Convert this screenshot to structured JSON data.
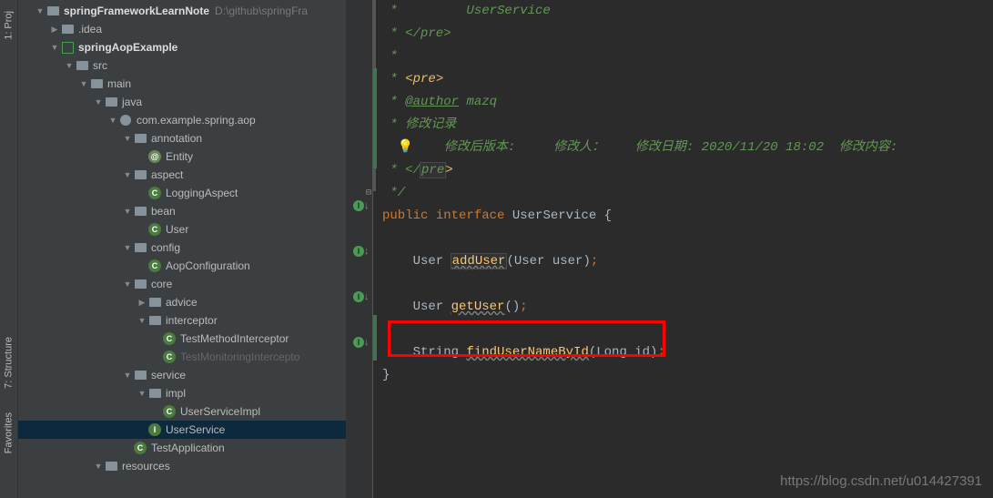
{
  "gutter_tabs": {
    "project": "1: Proj",
    "structure": "7: Structure",
    "favorites": "Favorites"
  },
  "tree": {
    "root": {
      "name": "springFrameworkLearnNote",
      "path": "D:\\github\\springFra"
    },
    "idea": ".idea",
    "module": "springAopExample",
    "src": "src",
    "main": "main",
    "java": "java",
    "pkg": "com.example.spring.aop",
    "annotation": {
      "dir": "annotation",
      "files": [
        "Entity"
      ]
    },
    "aspect": {
      "dir": "aspect",
      "files": [
        "LoggingAspect"
      ]
    },
    "bean": {
      "dir": "bean",
      "files": [
        "User"
      ]
    },
    "config": {
      "dir": "config",
      "files": [
        "AopConfiguration"
      ]
    },
    "core": {
      "dir": "core",
      "advice": "advice",
      "interceptor": "interceptor",
      "int_files": [
        "TestMethodInterceptor",
        "TestMonitoringIntercepto"
      ]
    },
    "service": {
      "dir": "service",
      "impl": "impl",
      "impl_files": [
        "UserServiceImpl"
      ],
      "files": [
        "UserService"
      ]
    },
    "testapp": "TestApplication",
    "resources": "resources"
  },
  "code": {
    "l1": " *         UserService",
    "l2": " * </pre>",
    "l3": " *",
    "l4_a": " * ",
    "l4_b": "<pre>",
    "l5_a": " * ",
    "l5_b": "@author",
    "l5_c": " mazq",
    "l6": " * 修改记录",
    "l7_a": "    修改后版本:     修改人：    修改日期: ",
    "l7_b": "2020/11/20 18:02",
    "l7_c": "  修改内容:",
    "l8_a": " * </",
    "l8_b": "pre",
    "l8_c": ">",
    "l9": " */",
    "l10_a": "public",
    "l10_b": " interface",
    "l10_c": " UserService {",
    "l12_a": "    User ",
    "l12_b": "addUser",
    "l12_c": "(User user)",
    "l12_d": ";",
    "l14_a": "    User ",
    "l14_b": "getUser",
    "l14_c": "()",
    "l14_d": ";",
    "l16_a": "    String ",
    "l16_b": "findUserNameById",
    "l16_c": "(Long id)",
    "l16_d": ";",
    "l17": "}"
  },
  "watermark": "https://blog.csdn.net/u014427391"
}
